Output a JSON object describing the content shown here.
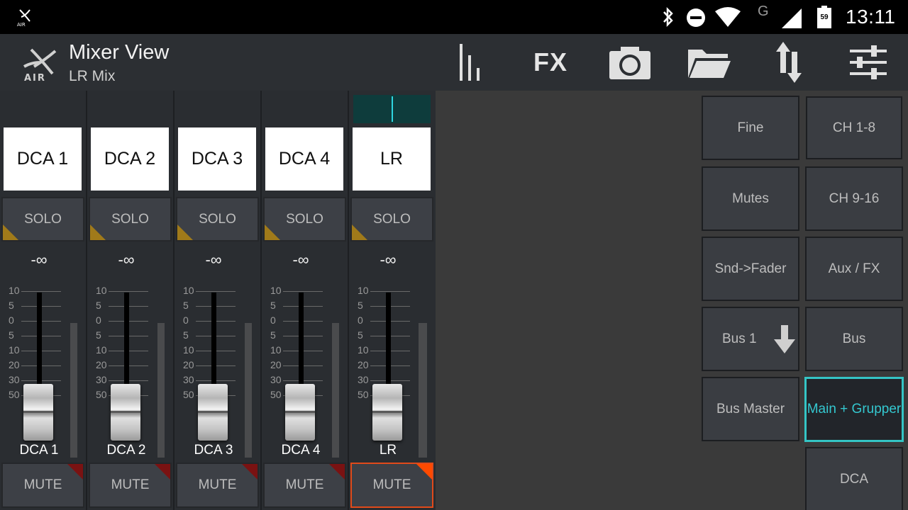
{
  "status": {
    "time": "13:11",
    "battery": "59",
    "network": "G"
  },
  "app": {
    "title": "Mixer View",
    "subtitle": "LR Mix"
  },
  "toolbar": {
    "fx_label": "FX"
  },
  "strips": [
    {
      "name": "DCA 1",
      "level": "-∞",
      "solo": "SOLO",
      "mute": "MUTE",
      "fader_label": "DCA 1"
    },
    {
      "name": "DCA 2",
      "level": "-∞",
      "solo": "SOLO",
      "mute": "MUTE",
      "fader_label": "DCA 2"
    },
    {
      "name": "DCA 3",
      "level": "-∞",
      "solo": "SOLO",
      "mute": "MUTE",
      "fader_label": "DCA 3"
    },
    {
      "name": "DCA 4",
      "level": "-∞",
      "solo": "SOLO",
      "mute": "MUTE",
      "fader_label": "DCA 4"
    },
    {
      "name": "LR",
      "level": "-∞",
      "solo": "SOLO",
      "mute": "MUTE",
      "fader_label": "LR"
    }
  ],
  "scale_ticks": [
    "10",
    "5",
    "0",
    "5",
    "10",
    "20",
    "30",
    "50"
  ],
  "right_buttons": {
    "fine": "Fine",
    "mutes": "Mutes",
    "snd_fader": "Snd->Fader",
    "bus1": "Bus 1",
    "bus_master": "Bus Master",
    "ch1_8": "CH 1-8",
    "ch9_16": "CH 9-16",
    "aux_fx": "Aux / FX",
    "bus": "Bus",
    "main_grupper": "Main + Grupper",
    "dca": "DCA"
  },
  "colors": {
    "accent": "#34c5c5",
    "solo_corner": "#a07a1a",
    "mute_corner": "#7a1212",
    "mute_active": "#ff4a00"
  }
}
